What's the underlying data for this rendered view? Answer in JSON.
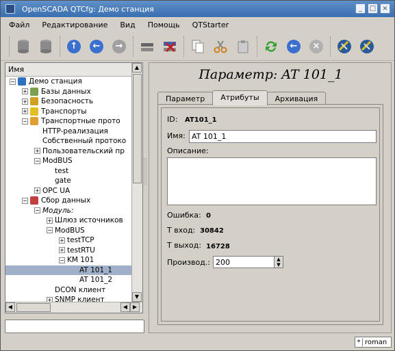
{
  "window": {
    "title": "OpenSCADA QTCfg: Демо станция"
  },
  "menu": [
    "Файл",
    "Редактирование",
    "Вид",
    "Помощь",
    "QTStarter"
  ],
  "toolbar": [
    {
      "name": "db-load-icon",
      "color": "#8a8a8a"
    },
    {
      "name": "db-save-icon",
      "color": "#8a8a8a"
    },
    {
      "name": "up-icon",
      "color": "#3b6fd0"
    },
    {
      "name": "back-icon",
      "color": "#3b6fd0"
    },
    {
      "name": "forward-icon",
      "color": "#9a9a9a"
    },
    {
      "name": "add-item-icon",
      "color": "#555555"
    },
    {
      "name": "delete-item-icon",
      "color": "#c02020"
    },
    {
      "name": "copy-icon",
      "color": "#dddddd"
    },
    {
      "name": "cut-icon",
      "color": "#d0a030"
    },
    {
      "name": "paste-icon",
      "color": "#bbbbbb"
    },
    {
      "name": "refresh-icon",
      "color": "#30a030"
    },
    {
      "name": "start-icon",
      "color": "#3b6fd0"
    },
    {
      "name": "stop-icon",
      "color": "#aaaaaa"
    },
    {
      "name": "qtcfg-icon",
      "color": "#2a5a9a"
    },
    {
      "name": "qtcfg2-icon",
      "color": "#2a5a9a"
    }
  ],
  "tree": {
    "header": "Имя",
    "rows": [
      {
        "label": "Демо станция",
        "level": 0,
        "exp": "-",
        "icon": "#3070c0"
      },
      {
        "label": "Базы данных",
        "level": 1,
        "exp": "+",
        "icon": "#7aa050"
      },
      {
        "label": "Безопасность",
        "level": 1,
        "exp": "+",
        "icon": "#d0a020"
      },
      {
        "label": "Транспорты",
        "level": 1,
        "exp": "+",
        "icon": "#e0c020"
      },
      {
        "label": "Транспортные прото",
        "level": 1,
        "exp": "-",
        "icon": "#e0a030"
      },
      {
        "label": "HTTP-реализация",
        "level": 2,
        "exp": "",
        "icon": ""
      },
      {
        "label": "Собственный протоко",
        "level": 2,
        "exp": "",
        "icon": ""
      },
      {
        "label": "Пользовательский пр",
        "level": 2,
        "exp": "+",
        "icon": ""
      },
      {
        "label": "ModBUS",
        "level": 2,
        "exp": "-",
        "icon": ""
      },
      {
        "label": "test",
        "level": 3,
        "exp": "",
        "icon": ""
      },
      {
        "label": "gate",
        "level": 3,
        "exp": "",
        "icon": ""
      },
      {
        "label": "OPC UA",
        "level": 2,
        "exp": "+",
        "icon": ""
      },
      {
        "label": "Сбор данных",
        "level": 1,
        "exp": "-",
        "icon": "#c04040"
      },
      {
        "label": "Модуль:",
        "level": 2,
        "exp": "-",
        "icon": "",
        "italic": true
      },
      {
        "label": "Шлюз источников",
        "level": 3,
        "exp": "+",
        "icon": ""
      },
      {
        "label": "ModBUS",
        "level": 3,
        "exp": "-",
        "icon": ""
      },
      {
        "label": "testTCP",
        "level": 4,
        "exp": "+",
        "icon": ""
      },
      {
        "label": "testRTU",
        "level": 4,
        "exp": "+",
        "icon": ""
      },
      {
        "label": "KM 101",
        "level": 4,
        "exp": "-",
        "icon": ""
      },
      {
        "label": "AT 101_1",
        "level": 5,
        "exp": "",
        "icon": "",
        "selected": true
      },
      {
        "label": "AT 101_2",
        "level": 5,
        "exp": "",
        "icon": ""
      },
      {
        "label": "DCON клиент",
        "level": 3,
        "exp": "",
        "icon": ""
      },
      {
        "label": "SNMP клиент",
        "level": 3,
        "exp": "+",
        "icon": ""
      }
    ]
  },
  "page": {
    "title": "Параметр: AT 101_1",
    "tabs": [
      "Параметр",
      "Атрибуты",
      "Архивация"
    ],
    "active_tab": 1
  },
  "form": {
    "id_label": "ID:",
    "id_value": "AT101_1",
    "name_label": "Имя:",
    "name_value": "AT 101_1",
    "desc_label": "Описание:",
    "desc_value": "",
    "error_label": "Ошибка:",
    "error_value": "0",
    "tin_label": "T вход:",
    "tin_value": "30842",
    "tout_label": "T выход:",
    "tout_value": "16728",
    "prod_label": "Производ.:",
    "prod_value": "200"
  },
  "statusbar": {
    "lang_marker": "*",
    "lang": "roman"
  }
}
